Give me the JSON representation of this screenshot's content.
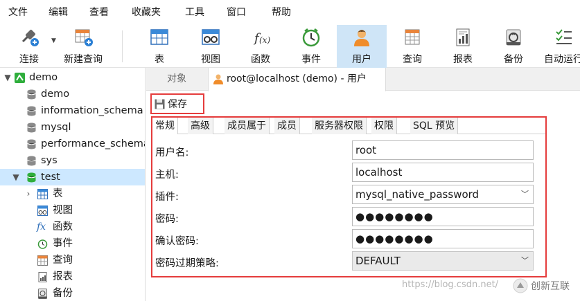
{
  "menu": [
    "文件",
    "编辑",
    "查看",
    "收藏夹",
    "工具",
    "窗口",
    "帮助"
  ],
  "toolbar": {
    "items": [
      {
        "label": "连接",
        "icon": "connect-icon"
      },
      {
        "label": "新建查询",
        "icon": "new-query-icon"
      },
      {
        "label": "表",
        "icon": "table-icon"
      },
      {
        "label": "视图",
        "icon": "view-icon"
      },
      {
        "label": "函数",
        "icon": "function-icon"
      },
      {
        "label": "事件",
        "icon": "event-clock-icon"
      },
      {
        "label": "用户",
        "icon": "user-icon",
        "active": true
      },
      {
        "label": "查询",
        "icon": "query-icon"
      },
      {
        "label": "报表",
        "icon": "report-icon"
      },
      {
        "label": "备份",
        "icon": "backup-icon"
      },
      {
        "label": "自动运行",
        "icon": "automation-icon"
      }
    ]
  },
  "sidebar": {
    "connection": "demo",
    "databases": [
      "demo",
      "information_schema",
      "mysql",
      "performance_schema",
      "sys",
      "test"
    ],
    "test_children": [
      "表",
      "视图",
      "函数",
      "事件",
      "查询",
      "报表",
      "备份"
    ]
  },
  "tabs": {
    "objects": "对象",
    "active": "root@localhost (demo) - 用户"
  },
  "save_label": "保存",
  "subtabs": [
    "常规",
    "高级",
    "成员属于",
    "成员",
    "服务器权限",
    "权限",
    "SQL 预览"
  ],
  "form": {
    "username_label": "用户名:",
    "username_value": "root",
    "host_label": "主机:",
    "host_value": "localhost",
    "plugin_label": "插件:",
    "plugin_value": "mysql_native_password",
    "password_label": "密码:",
    "password_value": "●●●●●●●●",
    "confirm_label": "确认密码:",
    "confirm_value": "●●●●●●●●",
    "expire_label": "密码过期策略:",
    "expire_value": "DEFAULT"
  },
  "watermark": "https://blog.csdn.net/",
  "brand": "创新互联",
  "colors": {
    "highlight_red": "#e53c3c",
    "selected_blue": "#cde8ff",
    "db_green": "#2fae3c"
  }
}
